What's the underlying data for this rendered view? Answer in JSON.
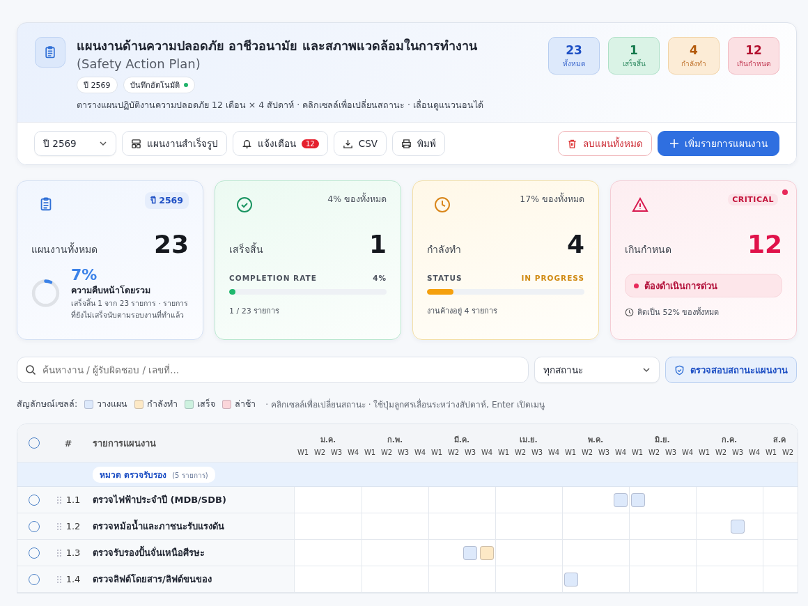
{
  "header": {
    "title": "แผนงานด้านความปลอดภัย อาชีวอนามัย และสภาพแวดล้อมในการทำงาน",
    "subtitle": "(Safety Action Plan)",
    "year_chip": "ปี 2569",
    "autosave": {
      "label": "บันทึกอัตโนมัติ",
      "on": true
    },
    "description": "ตารางแผนปฏิบัติงานความปลอดภัย 12 เดือน × 4 สัปดาห์ · คลิกเซลล์เพื่อเปลี่ยนสถานะ · เลื่อนดูแนวนอนได้",
    "counters": [
      {
        "kind": "total",
        "value": "23",
        "label": "ทั้งหมด"
      },
      {
        "kind": "done",
        "value": "1",
        "label": "เสร็จสิ้น"
      },
      {
        "kind": "progress",
        "value": "4",
        "label": "กำลังทำ"
      },
      {
        "kind": "overdue",
        "value": "12",
        "label": "เกินกำหนด"
      }
    ]
  },
  "toolbar": {
    "year_select": "ปี 2569",
    "template_button": "แผนงานสำเร็จรูป",
    "alerts_button": "แจ้งเตือน",
    "alerts_count": "12",
    "csv_button": "CSV",
    "print_button": "พิมพ์",
    "delete_button": "ลบแผนทั้งหมด",
    "add_button": "เพิ่มรายการแผนงาน"
  },
  "stats": [
    {
      "kind": "total",
      "badge": "ปี 2569",
      "label": "แผนงานทั้งหมด",
      "value": "23",
      "percent": "7%",
      "level": 0.07,
      "progress_title": "ความคืบหน้าโดยรวม",
      "note": "เสร็จสิ้น 1 จาก 23 รายการ · รายการที่ยังไม่เสร็จนับตามรอบงานที่ทำแล้ว"
    },
    {
      "kind": "done",
      "badge": "4% ของทั้งหมด",
      "label": "เสร็จสิ้น",
      "value": "1",
      "bar_label": "COMPLETION RATE",
      "bar_reading": "4%",
      "level": 0.04,
      "note": "1 / 23 รายการ"
    },
    {
      "kind": "progress",
      "badge": "17% ของทั้งหมด",
      "label": "กำลังทำ",
      "value": "4",
      "bar_label": "STATUS",
      "bar_reading": "IN PROGRESS",
      "level": 0.17,
      "note": "งานค้างอยู่ 4 รายการ"
    },
    {
      "kind": "overdue",
      "badge": "CRITICAL",
      "label": "เกินกำหนด",
      "value": "12",
      "alert": "ต้องดำเนินการด่วน",
      "note": "คิดเป็น 52% ของทั้งหมด"
    }
  ],
  "search": {
    "placeholder": "ค้นหางาน / ผู้รับผิดชอบ / เลขที่...",
    "status_select": "ทุกสถานะ",
    "check_button": "ตรวจสอบสถานะแผนงาน"
  },
  "legend": {
    "title": "สัญลักษณ์เซลล์:",
    "items": [
      {
        "color": "#dde9fb",
        "label": "วางแผน"
      },
      {
        "color": "#fde9c6",
        "label": "กำลังทำ"
      },
      {
        "color": "#cdf1df",
        "label": "เสร็จ"
      },
      {
        "color": "#fbd6da",
        "label": "ล่าช้า"
      }
    ],
    "hint": "· คลิกเซลล์เพื่อเปลี่ยนสถานะ · ใช้ปุ่มลูกศรเลื่อนระหว่างสัปดาห์, Enter เปิดเมนู"
  },
  "table": {
    "select_all": {
      "checked": false
    },
    "columns": [
      "#",
      "รายการแผนงาน"
    ],
    "months": [
      {
        "label": "ม.ค.",
        "weeks": [
          "W1",
          "W2",
          "W3",
          "W4"
        ]
      },
      {
        "label": "ก.พ.",
        "weeks": [
          "W1",
          "W2",
          "W3",
          "W4"
        ]
      },
      {
        "label": "มี.ค.",
        "weeks": [
          "W1",
          "W2",
          "W3",
          "W4"
        ]
      },
      {
        "label": "เม.ย.",
        "weeks": [
          "W1",
          "W2",
          "W3",
          "W4"
        ]
      },
      {
        "label": "พ.ค.",
        "weeks": [
          "W1",
          "W2",
          "W3",
          "W4"
        ]
      },
      {
        "label": "มิ.ย.",
        "weeks": [
          "W1",
          "W2",
          "W3",
          "W4"
        ]
      },
      {
        "label": "ก.ค.",
        "weeks": [
          "W1",
          "W2",
          "W3",
          "W4"
        ]
      },
      {
        "label": "ส.ค",
        "weeks": [
          "W1",
          "W2"
        ]
      }
    ],
    "group": {
      "title": "หมวด ตรวจรับรอง",
      "count": "(5 รายการ)"
    },
    "rows": [
      {
        "checked": false,
        "number": "1.1",
        "name": "ตรวจไฟฟ้าประจำปี (MDB/SDB)",
        "cells": [
          null,
          null,
          null,
          null,
          null,
          null,
          null,
          null,
          null,
          null,
          null,
          null,
          null,
          null,
          null,
          null,
          null,
          null,
          null,
          {
            "color": "#dde9fb"
          },
          {
            "color": "#dde9fb"
          },
          null,
          null,
          null,
          null,
          null,
          null,
          null,
          null,
          null
        ]
      },
      {
        "checked": false,
        "number": "1.2",
        "name": "ตรวจหม้อน้ำและภาชนะรับแรงดัน",
        "cells": [
          null,
          null,
          null,
          null,
          null,
          null,
          null,
          null,
          null,
          null,
          null,
          null,
          null,
          null,
          null,
          null,
          null,
          null,
          null,
          null,
          null,
          null,
          null,
          null,
          null,
          null,
          {
            "color": "#dde9fb"
          },
          null,
          null,
          null
        ]
      },
      {
        "checked": false,
        "number": "1.3",
        "name": "ตรวจรับรองปั้นจั่นเหนือศีรษะ",
        "cells": [
          null,
          null,
          null,
          null,
          null,
          null,
          null,
          null,
          null,
          null,
          {
            "color": "#dde9fb"
          },
          {
            "color": "#fde9c6"
          },
          null,
          null,
          null,
          null,
          null,
          null,
          null,
          null,
          null,
          null,
          null,
          null,
          null,
          null,
          null,
          null,
          null,
          null
        ]
      },
      {
        "checked": false,
        "number": "1.4",
        "name": "ตรวจลิฟต์โดยสาร/ลิฟต์ขนของ",
        "cells": [
          null,
          null,
          null,
          null,
          null,
          null,
          null,
          null,
          null,
          null,
          null,
          null,
          null,
          null,
          null,
          null,
          {
            "color": "#dde9fb"
          },
          null,
          null,
          null,
          null,
          null,
          null,
          null,
          null,
          null,
          null,
          null,
          null,
          null
        ]
      }
    ]
  }
}
